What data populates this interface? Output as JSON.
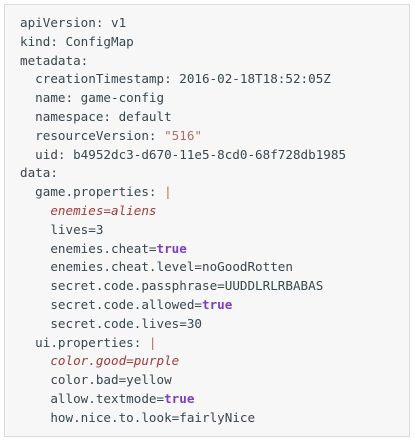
{
  "lines": [
    {
      "indent": "",
      "segments": [
        {
          "t": "apiVersion: v1"
        }
      ]
    },
    {
      "indent": "",
      "segments": [
        {
          "t": "kind: ConfigMap"
        }
      ]
    },
    {
      "indent": "",
      "segments": [
        {
          "t": "metadata:"
        }
      ]
    },
    {
      "indent": "  ",
      "segments": [
        {
          "t": "creationTimestamp: 2016-02-18T18:52:05Z"
        }
      ]
    },
    {
      "indent": "  ",
      "segments": [
        {
          "t": "name: game-config"
        }
      ]
    },
    {
      "indent": "  ",
      "segments": [
        {
          "t": "namespace: default"
        }
      ]
    },
    {
      "indent": "  ",
      "segments": [
        {
          "t": "resourceVersion: "
        },
        {
          "t": "\"516\"",
          "c": "str"
        }
      ]
    },
    {
      "indent": "  ",
      "segments": [
        {
          "t": "uid: b4952dc3-d670-11e5-8cd0-68f728db1985"
        }
      ]
    },
    {
      "indent": "",
      "segments": [
        {
          "t": "data:"
        }
      ]
    },
    {
      "indent": "  ",
      "segments": [
        {
          "t": "game.properties: "
        },
        {
          "t": "|",
          "c": "str"
        }
      ]
    },
    {
      "indent": "    ",
      "segments": [
        {
          "t": "enemies=aliens",
          "c": "it"
        }
      ]
    },
    {
      "indent": "    ",
      "segments": [
        {
          "t": "lives=3"
        }
      ]
    },
    {
      "indent": "    ",
      "segments": [
        {
          "t": "enemies.cheat="
        },
        {
          "t": "true",
          "c": "kw"
        }
      ]
    },
    {
      "indent": "    ",
      "segments": [
        {
          "t": "enemies.cheat.level=noGoodRotten"
        }
      ]
    },
    {
      "indent": "    ",
      "segments": [
        {
          "t": "secret.code.passphrase=UUDDLRLRBABAS"
        }
      ]
    },
    {
      "indent": "    ",
      "segments": [
        {
          "t": "secret.code.allowed="
        },
        {
          "t": "true",
          "c": "kw"
        }
      ]
    },
    {
      "indent": "    ",
      "segments": [
        {
          "t": "secret.code.lives=30"
        }
      ]
    },
    {
      "indent": "  ",
      "segments": [
        {
          "t": "ui.properties: "
        },
        {
          "t": "|",
          "c": "str"
        }
      ]
    },
    {
      "indent": "    ",
      "segments": [
        {
          "t": "color.good=purple",
          "c": "it"
        }
      ]
    },
    {
      "indent": "    ",
      "segments": [
        {
          "t": "color.bad=yellow"
        }
      ]
    },
    {
      "indent": "    ",
      "segments": [
        {
          "t": "allow.textmode="
        },
        {
          "t": "true",
          "c": "kw"
        }
      ]
    },
    {
      "indent": "    ",
      "segments": [
        {
          "t": "how.nice.to.look=fairlyNice"
        }
      ]
    }
  ],
  "colors": {
    "background": "#f7f7f7",
    "text": "#37474f",
    "string": "#b06e5f",
    "keyword": "#7c3fbf",
    "italic": "#a33b3b"
  }
}
